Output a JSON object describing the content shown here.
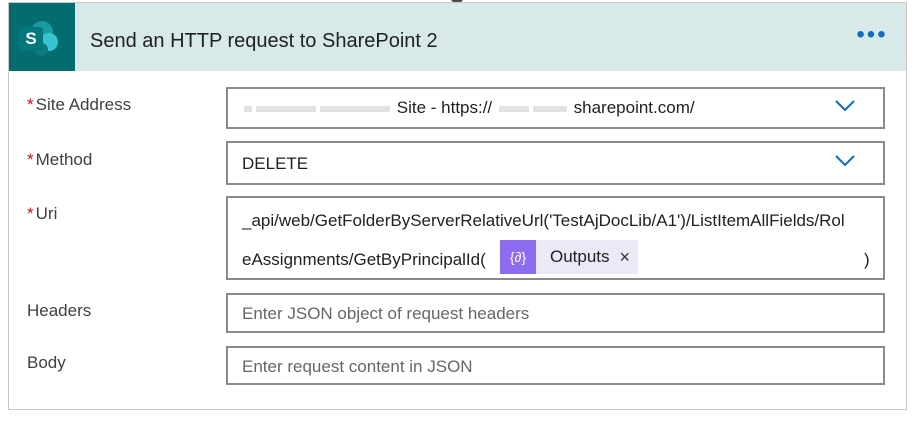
{
  "action": {
    "title": "Send an HTTP request to SharePoint 2",
    "more_label": "•••",
    "app_icon_letter": "S"
  },
  "fields": {
    "site_address": {
      "label": "Site Address",
      "required_mark": "*",
      "value_visible_part": "Site - https://",
      "value_visible_suffix": "sharepoint.com/"
    },
    "method": {
      "label": "Method",
      "required_mark": "*",
      "value": "DELETE"
    },
    "uri": {
      "label": "Uri",
      "required_mark": "*",
      "line1": "_api/web/GetFolderByServerRelativeUrl('TestAjDocLib/A1')/ListItemAllFields/Rol",
      "line2": "eAssignments/GetByPrincipalId(",
      "line2_suffix": ")",
      "token": {
        "icon": "{∂}",
        "label": "Outputs",
        "close": "×"
      }
    },
    "headers": {
      "label": "Headers",
      "placeholder": "Enter JSON object of request headers"
    },
    "body": {
      "label": "Body",
      "placeholder": "Enter request content in JSON"
    }
  },
  "icons": {
    "dropdown": "chevron-down-icon",
    "dynamic_content": "dynamic-content-icon",
    "app": "sharepoint-icon"
  },
  "colors": {
    "header_bg": "#d8e9ea",
    "sharepoint": "#036c70",
    "accent": "#0f6cbd",
    "required": "#c50f1f",
    "token": "#8c6cf0",
    "token_bg": "#ece8f8"
  }
}
